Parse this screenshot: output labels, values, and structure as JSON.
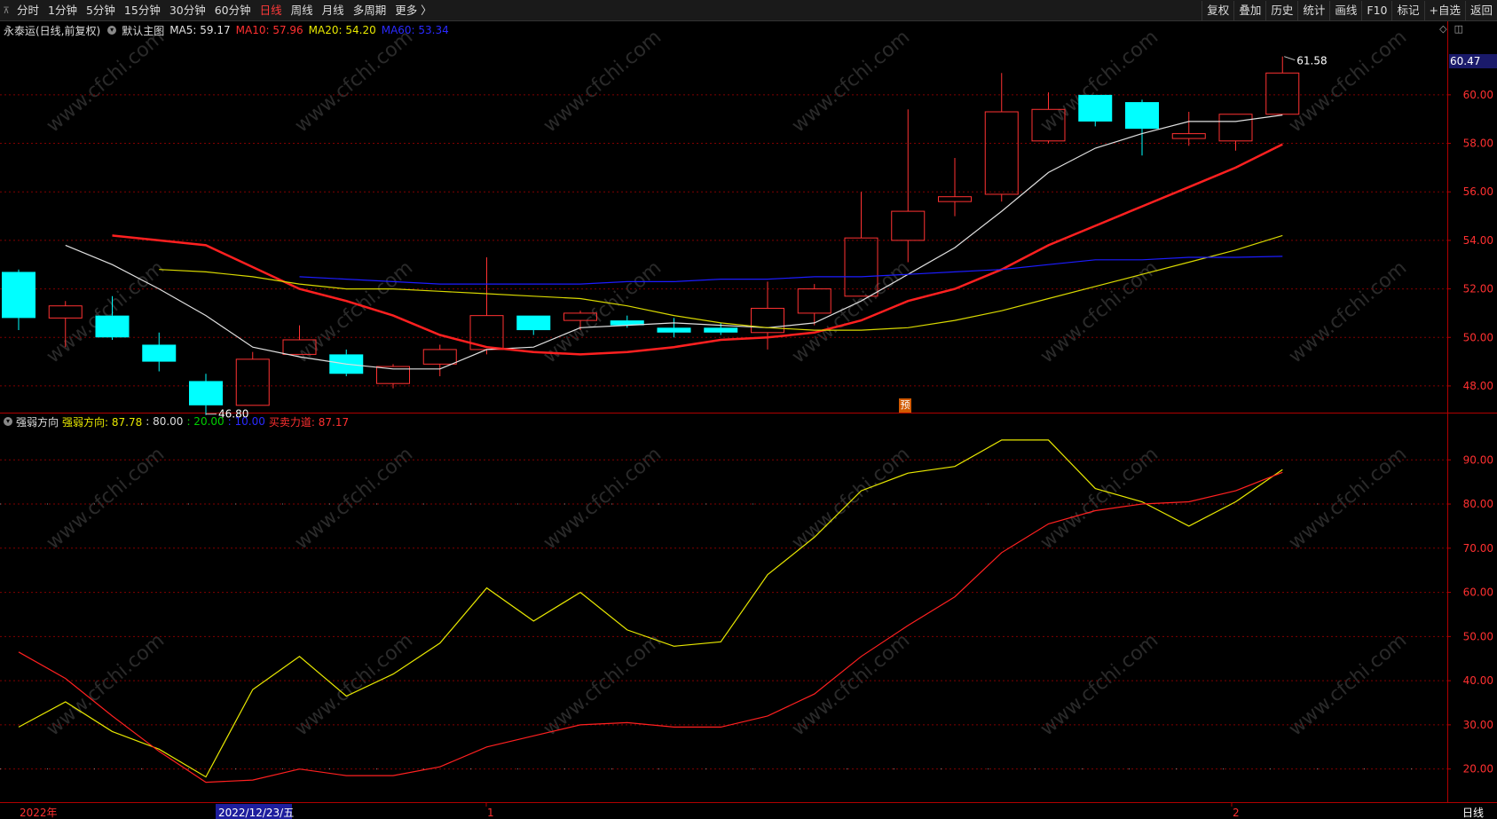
{
  "toolbar": {
    "periods": [
      "分时",
      "1分钟",
      "5分钟",
      "15分钟",
      "30分钟",
      "60分钟",
      "日线",
      "周线",
      "月线",
      "多周期",
      "更多 〉"
    ],
    "active_period": "日线",
    "tools": [
      "复权",
      "叠加",
      "历史",
      "统计",
      "画线",
      "F10",
      "标记",
      "+自选",
      "返回"
    ]
  },
  "main_info": {
    "stock_title": "永泰运(日线,前复权)",
    "template": "默认主图",
    "ma5": "MA5: 59.17",
    "ma10": "MA10: 57.96",
    "ma20": "MA20: 54.20",
    "ma60": "MA60: 53.34"
  },
  "indicator_info": {
    "name": "强弱方向",
    "line1": "强弱方向: 87.78",
    "level1": ": 80.00",
    "level2": ": 20.00",
    "level3": ": 10.00",
    "line2": "买卖力道: 87.17"
  },
  "prediction_badge": "预",
  "bottom": {
    "year_label": "2022年",
    "cursor_date": "2022/12/23/五",
    "month1": "1",
    "month2": "2",
    "period_label": "日线"
  },
  "colors": {
    "background": "#000000",
    "up": "#ff3232",
    "down": "#00ffff",
    "ma5": "#e0e0e0",
    "ma10": "#ff2020",
    "ma20": "#d8d800",
    "ma60": "#1c1cff",
    "grid": "#800000"
  },
  "chart_data": [
    {
      "type": "candlestick",
      "yaxis_ticks": [
        "48.00",
        "50.00",
        "52.00",
        "54.00",
        "56.00",
        "58.00",
        "60.00"
      ],
      "ylim": [
        46.9,
        62.3
      ],
      "current_price_label": "60.47",
      "current_price": 60.47,
      "high_annotation": "61.58",
      "high_value": 61.58,
      "low_annotation": "46.80",
      "low_value": 46.8,
      "candles": [
        {
          "o": 52.7,
          "h": 52.8,
          "l": 50.3,
          "c": 50.8
        },
        {
          "o": 50.8,
          "h": 51.5,
          "l": 49.6,
          "c": 51.3
        },
        {
          "o": 50.9,
          "h": 51.7,
          "l": 49.9,
          "c": 50.0
        },
        {
          "o": 49.7,
          "h": 50.2,
          "l": 48.6,
          "c": 49.0
        },
        {
          "o": 48.2,
          "h": 48.5,
          "l": 46.8,
          "c": 47.2
        },
        {
          "o": 47.2,
          "h": 49.4,
          "l": 47.2,
          "c": 49.1
        },
        {
          "o": 49.3,
          "h": 50.5,
          "l": 49.3,
          "c": 49.9
        },
        {
          "o": 49.3,
          "h": 49.5,
          "l": 48.4,
          "c": 48.5
        },
        {
          "o": 48.1,
          "h": 48.9,
          "l": 47.9,
          "c": 48.8
        },
        {
          "o": 48.9,
          "h": 49.7,
          "l": 48.4,
          "c": 49.5
        },
        {
          "o": 49.5,
          "h": 53.3,
          "l": 49.3,
          "c": 50.9
        },
        {
          "o": 50.9,
          "h": 50.9,
          "l": 50.1,
          "c": 50.3
        },
        {
          "o": 50.7,
          "h": 51.1,
          "l": 50.3,
          "c": 51.0
        },
        {
          "o": 50.7,
          "h": 50.9,
          "l": 50.4,
          "c": 50.5
        },
        {
          "o": 50.4,
          "h": 50.8,
          "l": 50.0,
          "c": 50.2
        },
        {
          "o": 50.4,
          "h": 50.6,
          "l": 50.1,
          "c": 50.2
        },
        {
          "o": 50.2,
          "h": 52.3,
          "l": 49.5,
          "c": 51.2
        },
        {
          "o": 51.0,
          "h": 52.2,
          "l": 50.5,
          "c": 52.0
        },
        {
          "o": 51.7,
          "h": 56.0,
          "l": 51.7,
          "c": 54.1
        },
        {
          "o": 54.0,
          "h": 59.4,
          "l": 53.1,
          "c": 55.2
        },
        {
          "o": 55.6,
          "h": 57.4,
          "l": 55.0,
          "c": 55.8
        },
        {
          "o": 55.9,
          "h": 60.9,
          "l": 55.6,
          "c": 59.3
        },
        {
          "o": 58.1,
          "h": 60.1,
          "l": 58.0,
          "c": 59.4
        },
        {
          "o": 60.0,
          "h": 60.0,
          "l": 58.7,
          "c": 58.9
        },
        {
          "o": 59.7,
          "h": 59.8,
          "l": 57.5,
          "c": 58.6
        },
        {
          "o": 58.2,
          "h": 59.3,
          "l": 57.9,
          "c": 58.4
        },
        {
          "o": 58.1,
          "h": 59.2,
          "l": 57.7,
          "c": 59.2
        },
        {
          "o": 59.2,
          "h": 61.58,
          "l": 59.2,
          "c": 60.9
        }
      ],
      "series": [
        {
          "name": "MA5",
          "values": [
            53.8,
            53.0,
            52.0,
            50.9,
            49.6,
            49.2,
            48.9,
            48.7,
            48.7,
            49.5,
            49.6,
            50.4,
            50.5,
            50.6,
            50.5,
            50.4,
            50.6,
            51.5,
            52.6,
            53.7,
            55.2,
            56.8,
            57.8,
            58.4,
            58.9,
            58.9,
            59.17
          ]
        },
        {
          "name": "MA10",
          "values": [
            54.2,
            54.0,
            53.8,
            52.9,
            52.0,
            51.5,
            50.9,
            50.1,
            49.6,
            49.4,
            49.3,
            49.4,
            49.6,
            49.9,
            50.0,
            50.2,
            50.7,
            51.5,
            52.0,
            52.8,
            53.8,
            54.6,
            55.4,
            56.2,
            57.0,
            57.96
          ]
        },
        {
          "name": "MA20",
          "values": [
            52.8,
            52.7,
            52.5,
            52.2,
            52.0,
            52.0,
            51.9,
            51.8,
            51.7,
            51.6,
            51.3,
            50.9,
            50.6,
            50.4,
            50.3,
            50.3,
            50.4,
            50.7,
            51.1,
            51.6,
            52.1,
            52.6,
            53.1,
            53.6,
            54.2
          ]
        },
        {
          "name": "MA60",
          "values": [
            52.5,
            52.4,
            52.3,
            52.2,
            52.2,
            52.2,
            52.2,
            52.3,
            52.3,
            52.4,
            52.4,
            52.5,
            52.5,
            52.6,
            52.7,
            52.8,
            53.0,
            53.2,
            53.2,
            53.3,
            53.3,
            53.34
          ]
        }
      ]
    },
    {
      "type": "line",
      "yaxis_ticks": [
        "20.00",
        "30.00",
        "40.00",
        "50.00",
        "60.00",
        "70.00",
        "80.00",
        "90.00"
      ],
      "ylim": [
        12.5,
        100.5
      ],
      "levels": [
        80,
        20,
        10
      ],
      "series": [
        {
          "name": "强弱方向",
          "values": [
            29.5,
            35.2,
            28.5,
            24.5,
            18.2,
            38.0,
            45.5,
            36.5,
            41.5,
            48.5,
            61.0,
            53.5,
            60.0,
            51.5,
            47.8,
            48.8,
            64.0,
            72.5,
            83.0,
            87.0,
            88.5,
            94.5,
            94.5,
            83.5,
            80.5,
            75.0,
            80.5,
            87.78
          ]
        },
        {
          "name": "买卖力道",
          "values": [
            46.5,
            40.5,
            32.0,
            24.0,
            17.0,
            17.5,
            20.0,
            18.5,
            18.5,
            20.5,
            25.0,
            27.5,
            30.0,
            30.5,
            29.5,
            29.5,
            32.0,
            37.0,
            45.5,
            52.5,
            59.0,
            69.0,
            75.5,
            78.5,
            80.0,
            80.5,
            83.0,
            87.17
          ]
        }
      ]
    }
  ]
}
